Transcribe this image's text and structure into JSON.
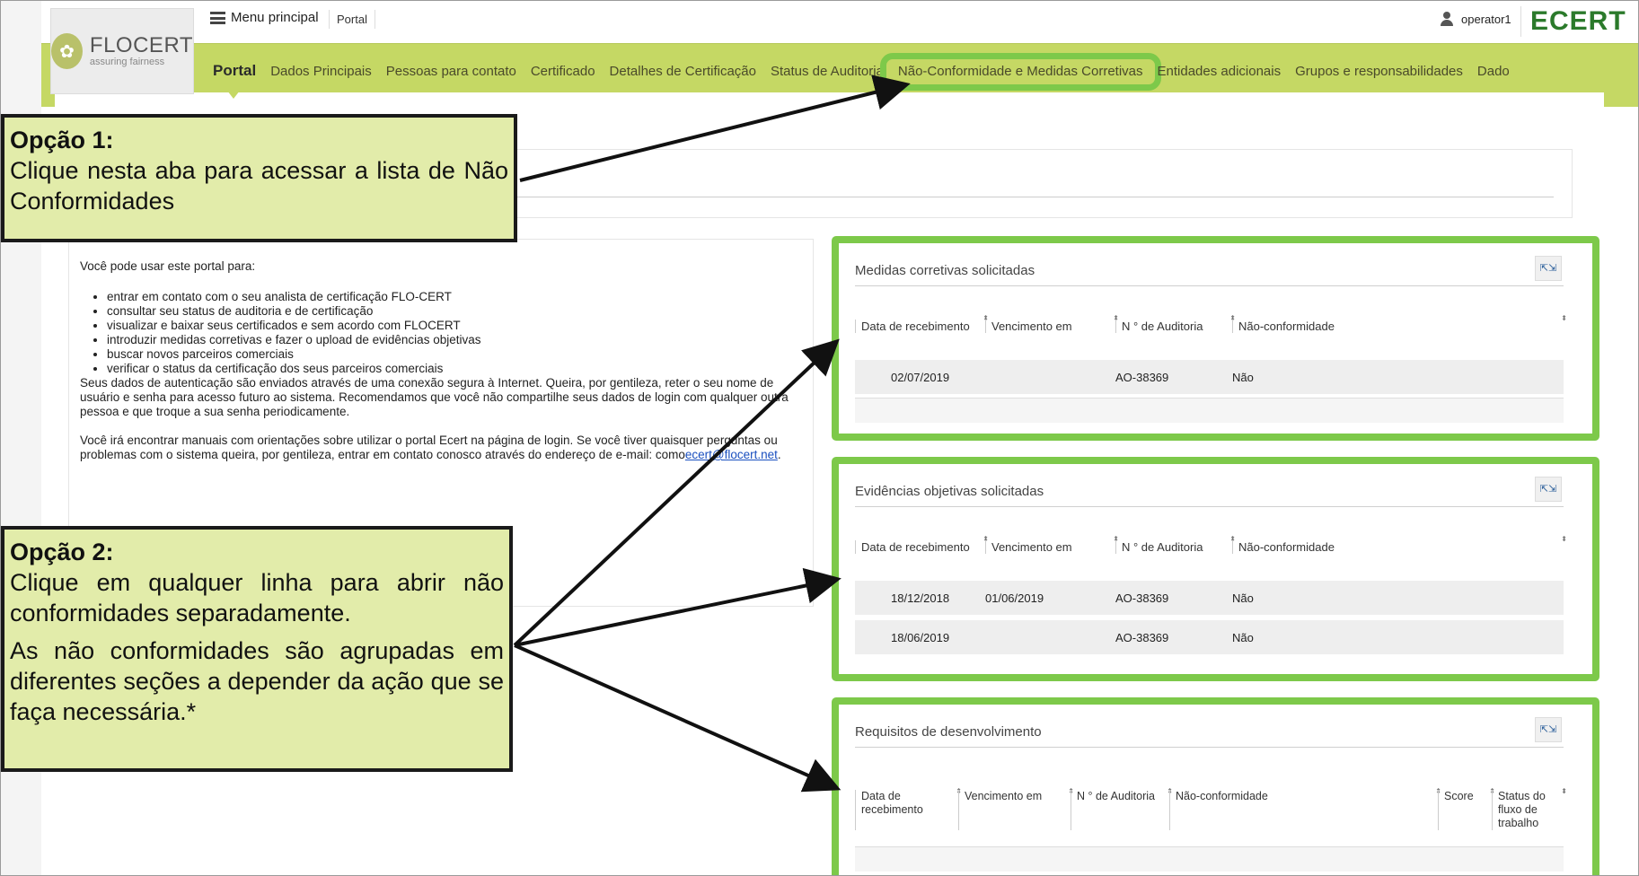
{
  "topbar": {
    "menu_label": "Menu principal",
    "crumb": "Portal",
    "user": "operator1",
    "brand_right": "ECERT"
  },
  "logo": {
    "name": "FLOCERT",
    "tagline": "assuring fairness"
  },
  "tabs": [
    {
      "label": "Portal"
    },
    {
      "label": "Dados Principais"
    },
    {
      "label": "Pessoas para contato"
    },
    {
      "label": "Certificado"
    },
    {
      "label": "Detalhes de Certificação"
    },
    {
      "label": "Status de Auditoria"
    },
    {
      "label": "Não-Conformidade e Medidas Corretivas"
    },
    {
      "label": "Entidades adicionais"
    },
    {
      "label": "Grupos e responsabilidades"
    },
    {
      "label": "Dado"
    }
  ],
  "intro": {
    "lead": "Você pode usar este portal para:",
    "items": [
      "entrar em contato com o seu analista de certificação FLO-CERT",
      "consultar seu status de auditoria e de certificação",
      "visualizar e baixar seus certificados e sem acordo com FLOCERT",
      "introduzir medidas corretivas e fazer o upload de evidências objetivas",
      "buscar novos parceiros comerciais",
      "verificar o status da certificação dos seus parceiros comerciais"
    ],
    "para1": "Seus dados de autenticação são enviados através de uma conexão segura à Internet. Queira, por gentileza, reter o seu nome de usuário e senha para acesso futuro ao sistema. Recomendamos que você não compartilhe seus dados de login com qualquer outra pessoa e que troque a sua senha periodicamente.",
    "para2": "Você irá encontrar manuais com orientações sobre utilizar o portal Ecert na página de login. Se você tiver quaisquer perguntas ou problemas com o sistema queira, por gentileza, entrar em contato conosco através do endereço de e-mail:",
    "para2_prefix": "como",
    "email": "ecert@flocert.net",
    "para2_suffix": "."
  },
  "panels": {
    "medidas": {
      "title": "Medidas corretivas solicitadas",
      "columns": [
        "Data de recebimento",
        "Vencimento em",
        "N ° de Auditoria",
        "Não-conformidade"
      ],
      "rows": [
        [
          "02/07/2019",
          "",
          "AO-38369",
          "Não"
        ]
      ]
    },
    "evidencias": {
      "title": "Evidências objetivas solicitadas",
      "columns": [
        "Data de recebimento",
        "Vencimento em",
        "N ° de Auditoria",
        "Não-conformidade"
      ],
      "rows": [
        [
          "18/12/2018",
          "01/06/2019",
          "AO-38369",
          "Não"
        ],
        [
          "18/06/2019",
          "",
          "AO-38369",
          "Não"
        ]
      ]
    },
    "requisitos": {
      "title": "Requisitos de desenvolvimento",
      "columns": [
        "Data de recebimento",
        "Vencimento em",
        "N ° de Auditoria",
        "Não-conformidade",
        "Score",
        "Status do fluxo de trabalho"
      ],
      "rows": []
    }
  },
  "callouts": {
    "opcao1_title": "Opção 1:",
    "opcao1_text": "Clique nesta aba para acessar a lista de Não Conformidades",
    "opcao2_title": "Opção 2:",
    "opcao2_text1": "Clique em qualquer linha para abrir não conformidades separadamente.",
    "opcao2_text2": "As não conformidades são agrupadas em diferentes seções a depender da ação que se faça necessária.*"
  },
  "colors": {
    "nav_green": "#c5d864",
    "highlight_green": "#7dc94a",
    "callout_fill": "#e2ecaa",
    "brand_green": "#2b7a2b"
  }
}
